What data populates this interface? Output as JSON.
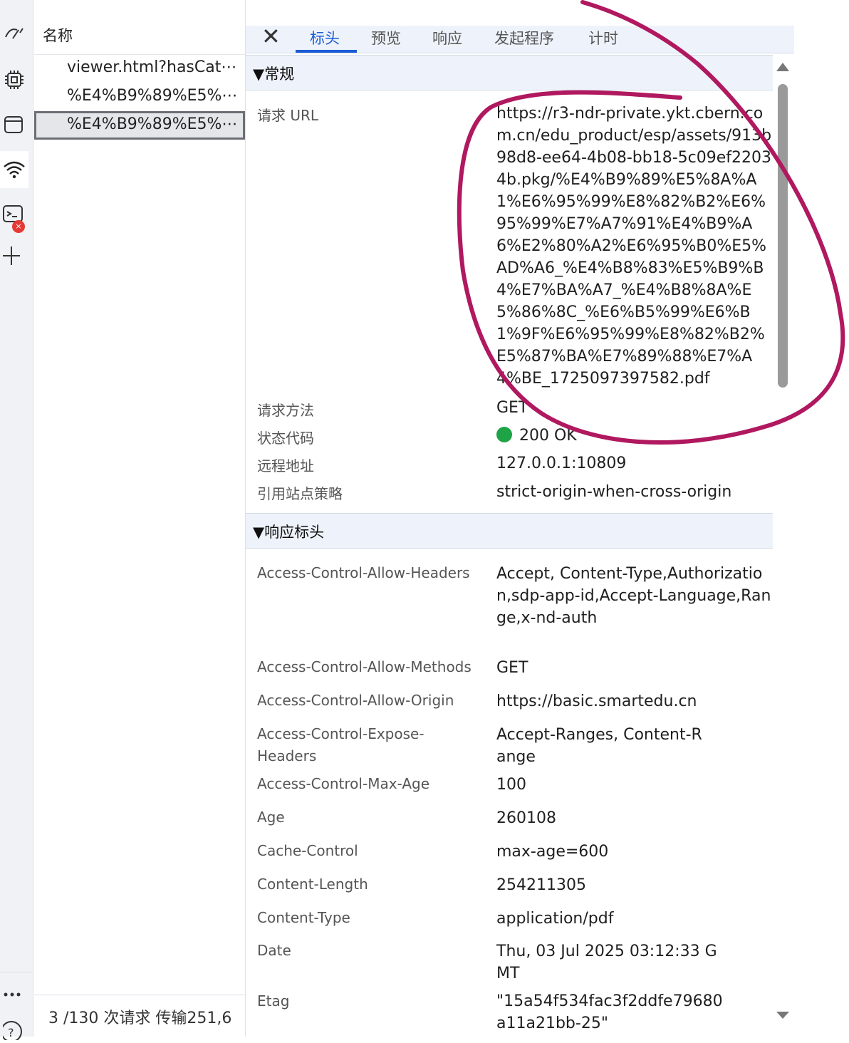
{
  "sidebar": {
    "icons": [
      "performance-icon",
      "cpu-chip-icon",
      "window-icon",
      "wifi-network-icon",
      "console-icon",
      "add-icon",
      "more-icon",
      "help-icon"
    ],
    "error_badge": "×"
  },
  "request_list": {
    "header": "名称",
    "rows": [
      {
        "name": "viewer.html?hasCat⋯",
        "selected": false
      },
      {
        "name": "%E4%B9%89%E5%⋯",
        "selected": false
      },
      {
        "name": "%E4%B9%89%E5%⋯",
        "selected": true
      }
    ],
    "footer": "3 /130 次请求  传输251,6"
  },
  "detail": {
    "close_label": "✕",
    "tabs": [
      "标头",
      "预览",
      "响应",
      "发起程序",
      "计时"
    ],
    "active_tab": "标头",
    "general": {
      "title": "▼常规",
      "request_url_label": "请求 URL",
      "request_url": "https://r3-ndr-private.ykt.cbern.com.cn/edu_product/esp/assets/913b98d8-ee64-4b08-bb18-5c09ef22034b.pkg/%E4%B9%89%E5%8A%A1%E6%95%99%E8%82%B2%E6%95%99%E7%A7%91%E4%B9%A6%E2%80%A2%E6%95%B0%E5%AD%A6_%E4%B8%83%E5%B9%B4%E7%BA%A7_%E4%B8%8A%E5%86%8C_%E6%B5%99%E6%B1%9F%E6%95%99%E8%82%B2%E5%87%BA%E7%89%88%E7%A4%BE_1725097397582.pdf",
      "method_label": "请求方法",
      "method": "GET",
      "status_label": "状态代码",
      "status": "200 OK",
      "status_color": "#1ea446",
      "remote_label": "远程地址",
      "remote": "127.0.0.1:10809",
      "referrer_label": "引用站点策略",
      "referrer": "strict-origin-when-cross-origin"
    },
    "response_headers": {
      "title": "▼响应标头",
      "rows": [
        {
          "key": "Access-Control-Allow-Headers",
          "value": "Accept, Content-Type,Authorization,sdp-app-id,Accept-Language,Range,x-nd-auth"
        },
        {
          "key": "Access-Control-Allow-Methods",
          "value": "GET"
        },
        {
          "key": "Access-Control-Allow-Origin",
          "value": "https://basic.smartedu.cn"
        },
        {
          "key": "Access-Control-Expose-Headers",
          "value": "Accept-Ranges, Content-Range"
        },
        {
          "key": "Access-Control-Max-Age",
          "value": "100"
        },
        {
          "key": "Age",
          "value": "260108"
        },
        {
          "key": "Cache-Control",
          "value": "max-age=600"
        },
        {
          "key": "Content-Length",
          "value": "254211305"
        },
        {
          "key": "Content-Type",
          "value": "application/pdf"
        },
        {
          "key": "Date",
          "value": "Thu, 03 Jul 2025 03:12:33 GMT"
        },
        {
          "key": "Etag",
          "value": "\"15a54f534fac3f2ddfe79680a11a21bb-25\""
        }
      ]
    }
  },
  "colors": {
    "accent": "#1a5bd6",
    "annotation": "#b0185f",
    "section_bg": "#eef3fb"
  }
}
